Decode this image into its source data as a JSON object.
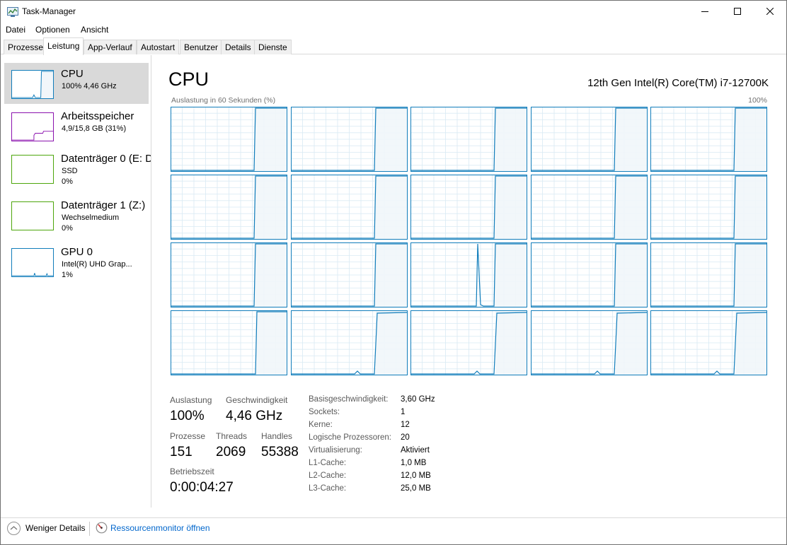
{
  "window": {
    "title": "Task-Manager"
  },
  "menu": [
    "Datei",
    "Optionen",
    "Ansicht"
  ],
  "tabs": [
    "Prozesse",
    "Leistung",
    "App-Verlauf",
    "Autostart",
    "Benutzer",
    "Details",
    "Dienste"
  ],
  "active_tab": "Leistung",
  "sidebar": [
    {
      "title": "CPU",
      "lines": [
        "100% 4,46 GHz"
      ],
      "color": "#117dbb"
    },
    {
      "title": "Arbeitsspeicher",
      "lines": [
        "4,9/15,8 GB (31%)"
      ],
      "color": "#8b12ae"
    },
    {
      "title": "Datenträger 0 (E: D",
      "lines": [
        "SSD",
        "0%"
      ],
      "color": "#4da60c"
    },
    {
      "title": "Datenträger 1 (Z:)",
      "lines": [
        "Wechselmedium",
        "0%"
      ],
      "color": "#4da60c"
    },
    {
      "title": "GPU 0",
      "lines": [
        "Intel(R) UHD Grap...",
        "1%"
      ],
      "color": "#117dbb"
    }
  ],
  "main": {
    "title": "CPU",
    "processor": "12th Gen Intel(R) Core(TM) i7-12700K",
    "graph_label": "Auslastung in 60 Sekunden (%)",
    "graph_max": "100%",
    "logical_processor_count": 20
  },
  "stats": {
    "auslastung_label": "Auslastung",
    "auslastung": "100%",
    "geschw_label": "Geschwindigkeit",
    "geschw": "4,46 GHz",
    "prozesse_label": "Prozesse",
    "prozesse": "151",
    "threads_label": "Threads",
    "threads": "2069",
    "handles_label": "Handles",
    "handles": "55388",
    "betriebszeit_label": "Betriebszeit",
    "betriebszeit": "0:00:04:27"
  },
  "info": [
    {
      "label": "Basisgeschwindigkeit:",
      "value": "3,60 GHz"
    },
    {
      "label": "Sockets:",
      "value": "1"
    },
    {
      "label": "Kerne:",
      "value": "12"
    },
    {
      "label": "Logische Prozessoren:",
      "value": "20"
    },
    {
      "label": "Virtualisierung:",
      "value": "Aktiviert"
    },
    {
      "label": "L1-Cache:",
      "value": "1,0 MB"
    },
    {
      "label": "L2-Cache:",
      "value": "12,0 MB"
    },
    {
      "label": "L3-Cache:",
      "value": "25,0 MB"
    }
  ],
  "footer": {
    "less_details": "Weniger Details",
    "resource_monitor": "Ressourcenmonitor öffnen"
  },
  "colors": {
    "cpu_line": "#117dbb",
    "cpu_fill": "#f1f6fa",
    "grid": "#d9eaf4"
  }
}
